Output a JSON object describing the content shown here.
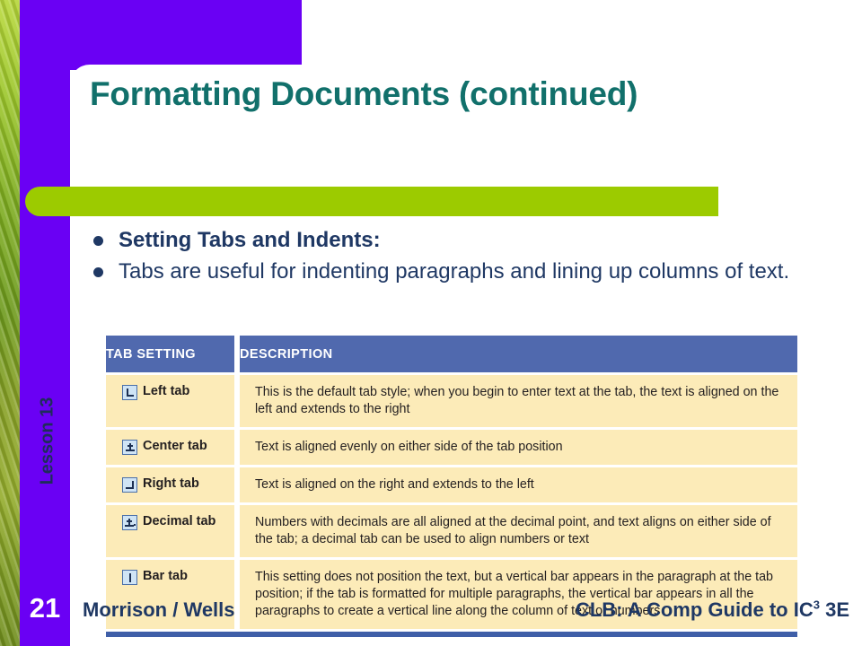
{
  "slide": {
    "number": "21",
    "lesson_label": "Lesson 13",
    "title": "Formatting Documents (continued)",
    "colors": {
      "purple": "#6a00f4",
      "green_bar": "#9ccb00",
      "title_teal": "#11706b",
      "body_navy": "#1f3864",
      "table_header_blue": "#5069ae",
      "table_row_cream": "#fcebb8",
      "table_bottom_rule": "#3f5fa8",
      "tab_icon_fill": "#cfe4f5"
    }
  },
  "bullets": [
    {
      "text": "Setting Tabs and Indents:",
      "bold": true
    },
    {
      "text": "Tabs are useful for indenting paragraphs and lining up columns of text.",
      "bold": false
    }
  ],
  "table": {
    "headers": {
      "col1": "TAB SETTING",
      "col2": "DESCRIPTION"
    },
    "rows": [
      {
        "icon": "left-tab-icon",
        "name": "Left tab",
        "description": "This is the default tab style; when you begin to enter text at the tab, the text is aligned on the left and extends to the right"
      },
      {
        "icon": "center-tab-icon",
        "name": "Center tab",
        "description": "Text is aligned evenly on either side of the tab position"
      },
      {
        "icon": "right-tab-icon",
        "name": "Right tab",
        "description": "Text is aligned on the right and extends to the left"
      },
      {
        "icon": "decimal-tab-icon",
        "name": "Decimal tab",
        "description": "Numbers with decimals are all aligned at the decimal point, and text aligns on either side of the tab; a decimal tab can be used to align numbers or text"
      },
      {
        "icon": "bar-tab-icon",
        "name": "Bar tab",
        "description": "This setting does not position the text, but a vertical bar appears in the paragraph at the tab position; if the tab is formatted for multiple paragraphs, the vertical bar appears in all the paragraphs to create a vertical line along the column of text or numbers"
      }
    ]
  },
  "footer": {
    "authors": "Morrison / Wells",
    "book_prefix": "CLB: A Comp Guide to IC",
    "book_superscript": "3",
    "book_suffix": " 3E"
  }
}
